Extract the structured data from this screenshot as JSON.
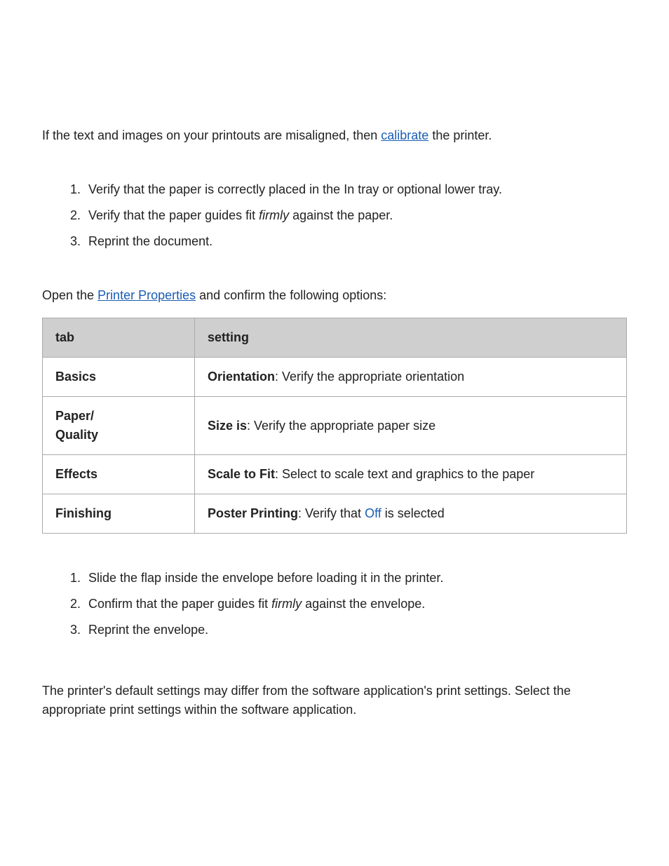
{
  "intro": {
    "before_link": "If the text and images on your printouts are misaligned, then ",
    "link": "calibrate",
    "after_link": " the printer."
  },
  "steps1": {
    "items": [
      "Verify that the paper is correctly placed in the In tray or optional lower tray.",
      {
        "before": "Verify that the paper guides fit ",
        "em": "firmly",
        "after": " against the paper."
      },
      "Reprint the document."
    ]
  },
  "table_intro": {
    "before_link": "Open the ",
    "link": "Printer Properties",
    "after_link": " and confirm the following options:"
  },
  "table": {
    "headers": {
      "tab": "tab",
      "setting": "setting"
    },
    "rows": [
      {
        "tab": "Basics",
        "label": "Orientation",
        "desc": ": Verify the appropriate orientation"
      },
      {
        "tab": "Paper/\nQuality",
        "label": "Size is",
        "desc": ": Verify the appropriate paper size"
      },
      {
        "tab": "Effects",
        "label": "Scale to Fit",
        "desc": ": Select to scale text and graphics to the paper"
      },
      {
        "tab": "Finishing",
        "label": "Poster Printing",
        "desc_before": ": Verify that ",
        "off": "Off",
        "desc_after": " is selected"
      }
    ]
  },
  "steps2": {
    "items": [
      "Slide the flap inside the envelope before loading it in the printer.",
      {
        "before": "Confirm that the paper guides fit ",
        "em": "firmly",
        "after": " against the envelope."
      },
      "Reprint the envelope."
    ]
  },
  "default_note": "The printer's default settings may differ from the software application's print settings. Select the appropriate print settings within the software application."
}
